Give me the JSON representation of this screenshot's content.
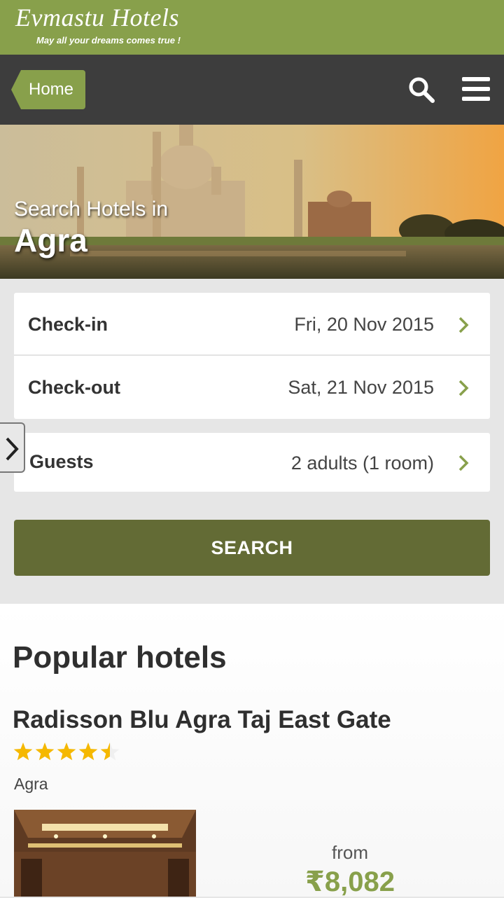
{
  "brand": {
    "name": "Evmastu Hotels",
    "tagline": "May all your dreams comes true !"
  },
  "nav": {
    "home_label": "Home",
    "icons": [
      "search-icon",
      "menu-icon"
    ]
  },
  "hero": {
    "subtitle": "Search Hotels in",
    "city": "Agra"
  },
  "form": {
    "checkin": {
      "label": "Check-in",
      "value": "Fri, 20 Nov 2015"
    },
    "checkout": {
      "label": "Check-out",
      "value": "Sat, 21 Nov 2015"
    },
    "guests": {
      "label": "Guests",
      "value": "2 adults (1 room)"
    },
    "search_label": "SEARCH"
  },
  "popular": {
    "heading": "Popular hotels",
    "hotels": [
      {
        "name": "Radisson Blu Agra Taj East Gate",
        "rating": 4.5,
        "location": "Agra",
        "from_label": "from",
        "price": "₹8,082"
      }
    ]
  },
  "colors": {
    "brand_green": "#88a04b",
    "nav_dark": "#3d3d3d",
    "button_olive": "#636b35",
    "star_gold": "#f5b800"
  }
}
